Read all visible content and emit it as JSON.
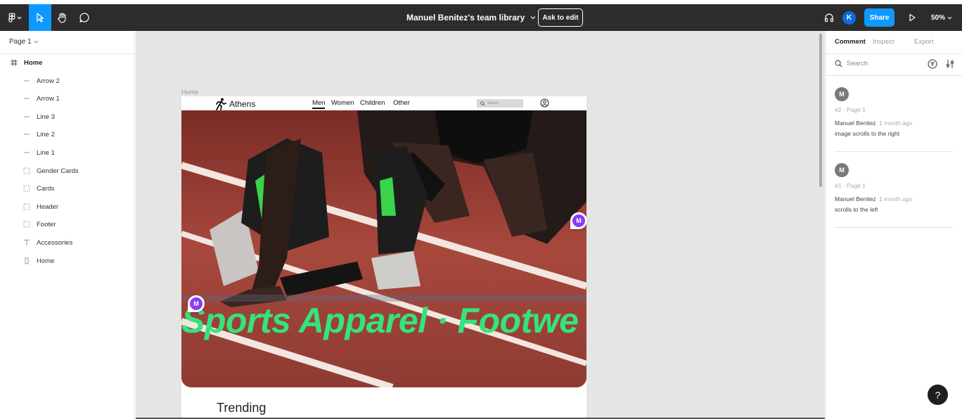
{
  "toolbar": {
    "file_title": "Manuel Benitez's team library",
    "ask_to_edit": "Ask to edit",
    "avatar_initial": "K",
    "share": "Share",
    "zoom": "50%",
    "tools": [
      "figma-menu-icon",
      "move-tool-icon",
      "hand-tool-icon",
      "comment-tool-icon"
    ],
    "active_tool": "move-tool-icon"
  },
  "left_panel": {
    "page": "Page 1",
    "layers": [
      {
        "label": "Home",
        "icon": "frame-icon",
        "top": true
      },
      {
        "label": "Arrow 2",
        "icon": "line-icon"
      },
      {
        "label": "Arrow 1",
        "icon": "line-icon"
      },
      {
        "label": "Line 3",
        "icon": "line-icon"
      },
      {
        "label": "Line 2",
        "icon": "line-icon"
      },
      {
        "label": "Line 1",
        "icon": "line-icon"
      },
      {
        "label": "Gender Cards",
        "icon": "component-frame-icon"
      },
      {
        "label": "Cards",
        "icon": "component-frame-icon"
      },
      {
        "label": "Header",
        "icon": "component-frame-icon"
      },
      {
        "label": "Footer",
        "icon": "component-frame-icon"
      },
      {
        "label": "Accessories",
        "icon": "text-icon"
      },
      {
        "label": "Home",
        "icon": "rectangle-icon"
      }
    ]
  },
  "canvas": {
    "frame_label": "Home",
    "site": {
      "brand": "Athens",
      "nav": [
        "Men",
        "Women",
        "Children",
        "Other"
      ],
      "active_nav": "Men",
      "search_placeholder": "Search",
      "hero_text": "Sports Apparel · Footwe",
      "trending": "Trending",
      "accent_color": "#35e37c"
    },
    "comment_pins": [
      "M",
      "M"
    ]
  },
  "right_panel": {
    "tabs": [
      "Comment",
      "Inspect",
      "Export"
    ],
    "active_tab": "Comment",
    "search_placeholder": "Search",
    "comments": [
      {
        "avatar": "M",
        "ref": "#2 · Page 1",
        "author": "Manuel Benitez",
        "time": "1 month ago",
        "body": "image scrolls to the right"
      },
      {
        "avatar": "M",
        "ref": "#1 · Page 1",
        "author": "Manuel Benitez",
        "time": "1 month ago",
        "body": "scrolls to the left"
      }
    ],
    "help": "?"
  }
}
